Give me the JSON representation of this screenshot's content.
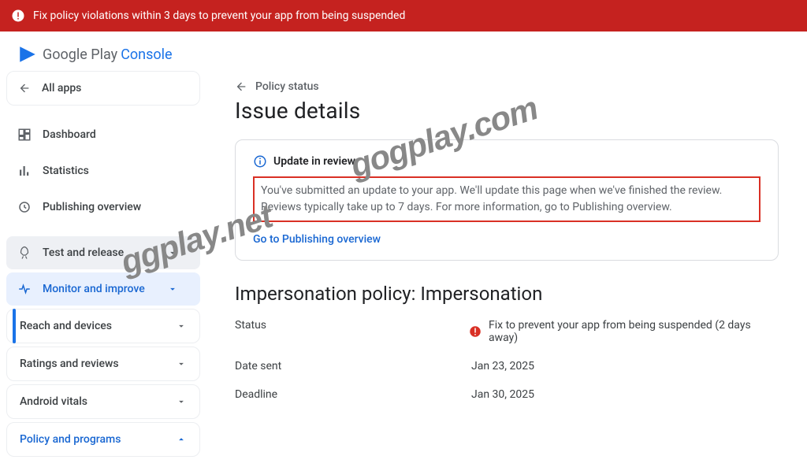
{
  "alert": {
    "text": "Fix policy violations within 3 days to prevent your app from being suspended"
  },
  "logo": {
    "part1": "Google Play",
    "part2": "Console"
  },
  "sidebar": {
    "all_apps": "All apps",
    "items": [
      {
        "label": "Dashboard"
      },
      {
        "label": "Statistics"
      },
      {
        "label": "Publishing overview"
      },
      {
        "label": "Test and release"
      },
      {
        "label": "Monitor and improve"
      }
    ],
    "pills": [
      {
        "label": "Reach and devices"
      },
      {
        "label": "Ratings and reviews"
      },
      {
        "label": "Android vitals"
      },
      {
        "label": "Policy and programs"
      }
    ]
  },
  "breadcrumb": {
    "label": "Policy status"
  },
  "page": {
    "title": "Issue details"
  },
  "card": {
    "head": "Update in review",
    "body": "You've submitted an update to your app. We'll update this page when we've finished the review. Reviews typically take up to 7 days. For more information, go to Publishing overview.",
    "link": "Go to Publishing overview"
  },
  "section": {
    "title": "Impersonation policy: Impersonation"
  },
  "rows": {
    "status_key": "Status",
    "status_val": "Fix to prevent your app from being suspended (2 days away)",
    "date_key": "Date sent",
    "date_val": "Jan 23, 2025",
    "deadline_key": "Deadline",
    "deadline_val": "Jan 30, 2025"
  },
  "watermarks": {
    "wm1": "gogplay.com",
    "wm2": "ggplay.net"
  }
}
